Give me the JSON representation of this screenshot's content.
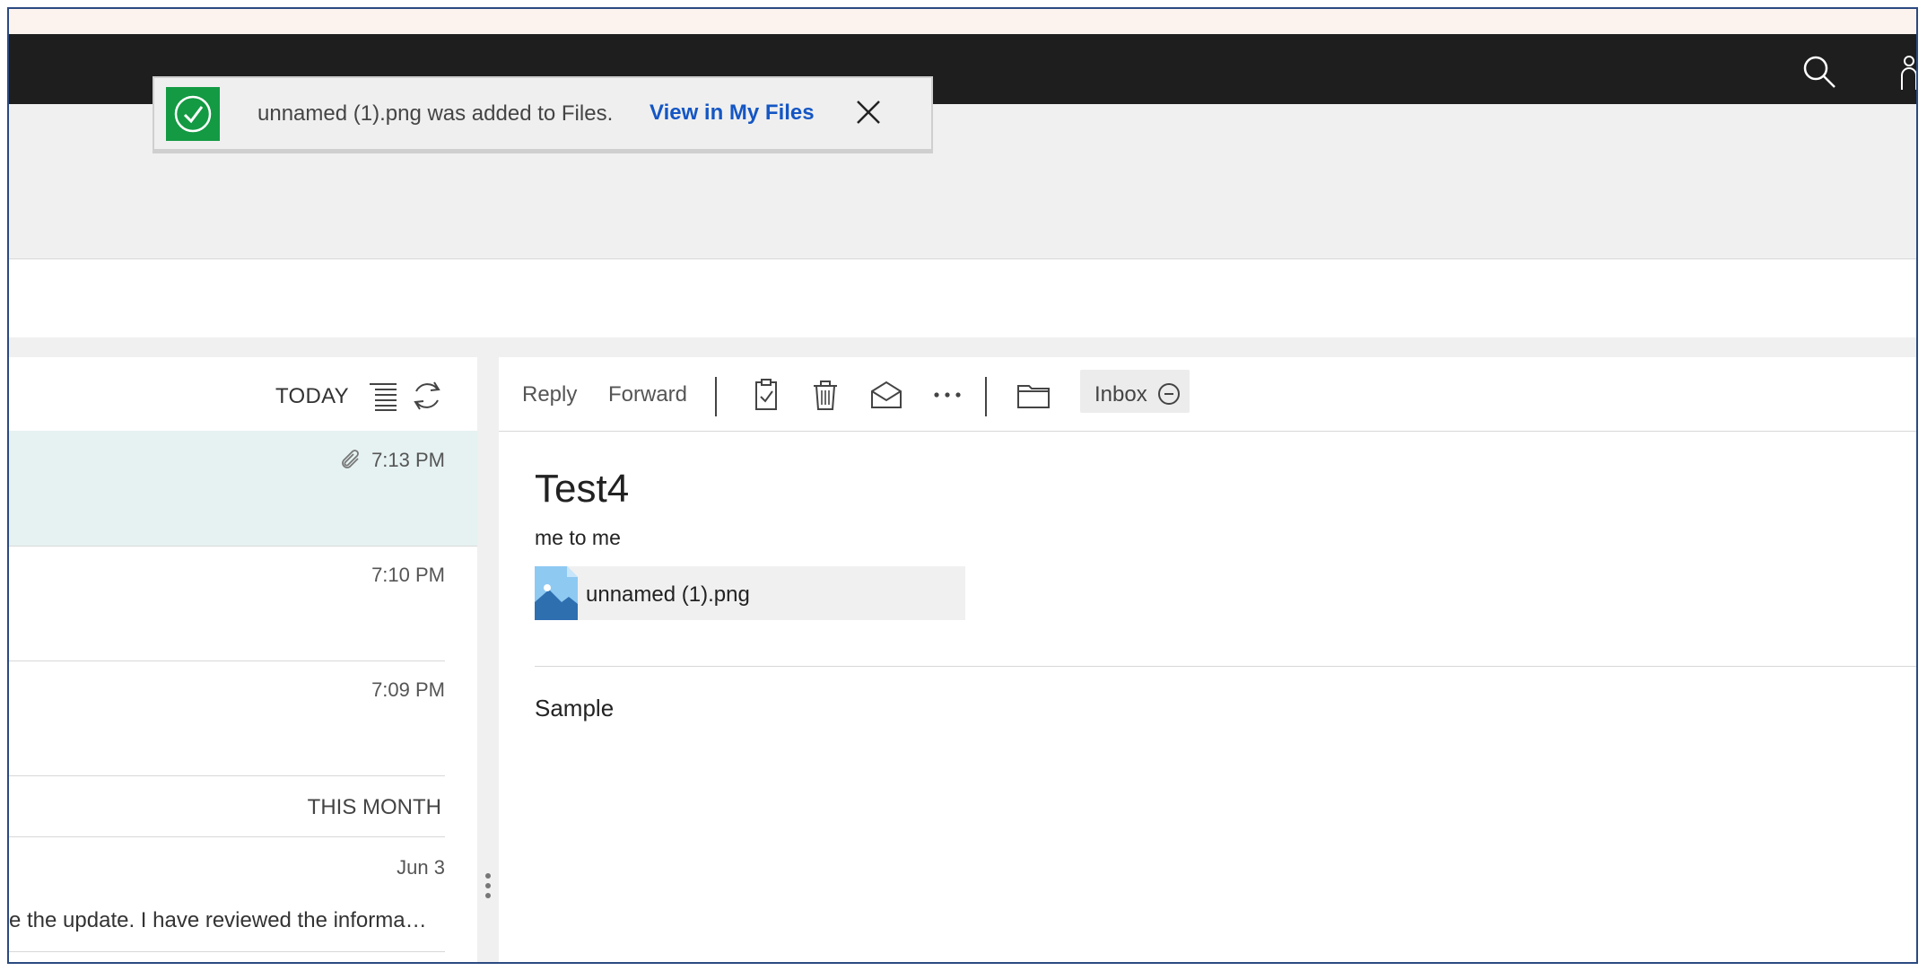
{
  "toast": {
    "message": "unnamed (1).png was added to Files.",
    "link": "View in My Files",
    "accent": "#139a43",
    "link_color": "#1456c4"
  },
  "list": {
    "today_label": "TODAY",
    "messages": [
      {
        "time": "7:13 PM",
        "has_attachment": true,
        "selected": true
      },
      {
        "time": "7:10 PM"
      },
      {
        "time": "7:09 PM"
      }
    ],
    "this_month_label": "THIS MONTH",
    "month_messages": [
      {
        "time": "Jun 3",
        "preview": "e the update. I have reviewed the informa…"
      }
    ]
  },
  "toolbar": {
    "reply": "Reply",
    "forward": "Forward",
    "folder_label": "Inbox"
  },
  "email": {
    "subject": "Test4",
    "from_to": "me to me",
    "attachment_name": "unnamed (1).png",
    "body": "Sample"
  },
  "icons": [
    "search-icon",
    "user-icon",
    "check-icon",
    "close-icon",
    "sort-icon",
    "refresh-icon",
    "paperclip-icon",
    "clipboard-check-icon",
    "trash-icon",
    "open-envelope-icon",
    "more-icon",
    "folder-icon",
    "minus-circle-icon",
    "image-file-icon"
  ]
}
